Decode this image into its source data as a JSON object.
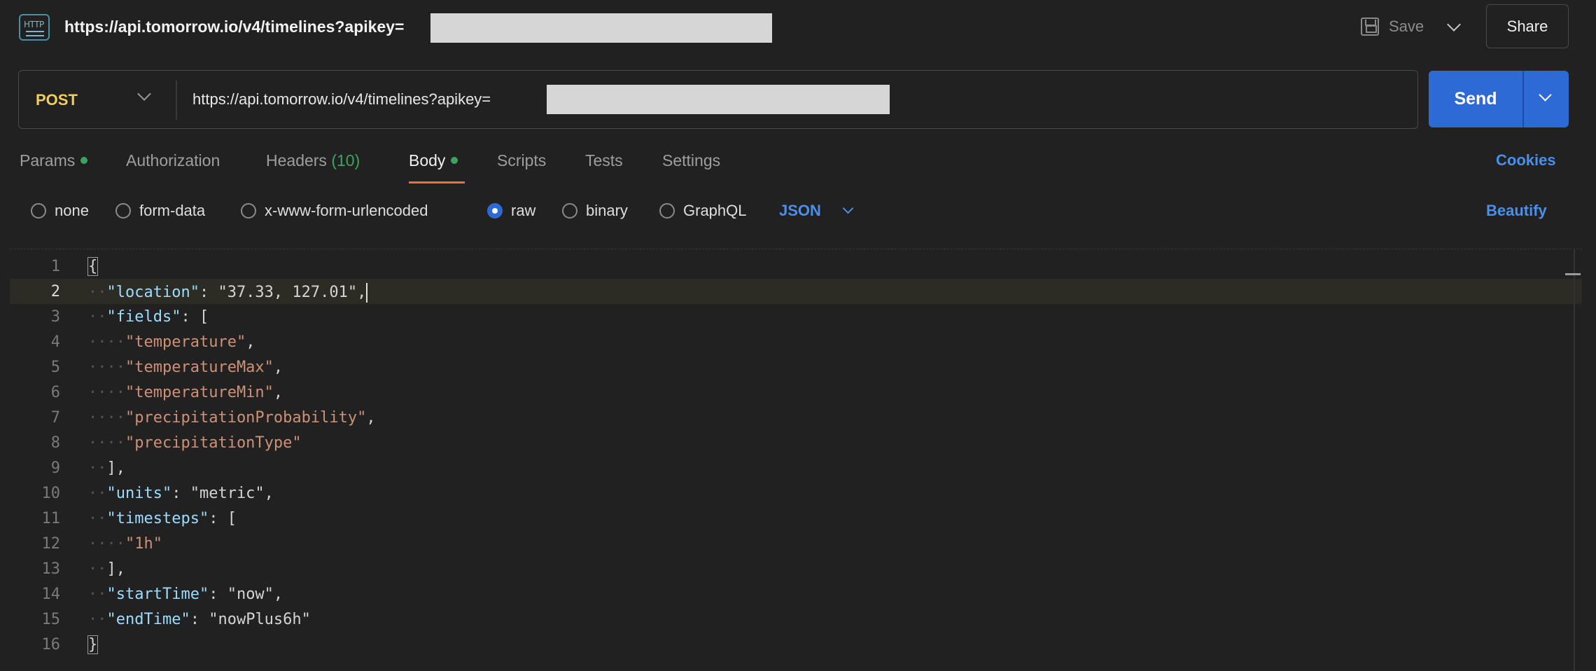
{
  "topbar": {
    "icon": "http-request-icon",
    "icon_text": "HTTP",
    "title": "https://api.tomorrow.io/v4/timelines?apikey=",
    "save_label": "Save",
    "share_label": "Share"
  },
  "request": {
    "method": "POST",
    "url": "https://api.tomorrow.io/v4/timelines?apikey=",
    "send_label": "Send"
  },
  "tabs": [
    {
      "label": "Params",
      "dot": true
    },
    {
      "label": "Authorization"
    },
    {
      "label": "Headers",
      "count": "(10)"
    },
    {
      "label": "Body",
      "dot": true,
      "active": true
    },
    {
      "label": "Scripts"
    },
    {
      "label": "Tests"
    },
    {
      "label": "Settings"
    }
  ],
  "cookies_label": "Cookies",
  "body_types": [
    {
      "label": "none",
      "selected": false
    },
    {
      "label": "form-data",
      "selected": false
    },
    {
      "label": "x-www-form-urlencoded",
      "selected": false
    },
    {
      "label": "raw",
      "selected": true
    },
    {
      "label": "binary",
      "selected": false
    },
    {
      "label": "GraphQL",
      "selected": false
    }
  ],
  "language": "JSON",
  "beautify_label": "Beautify",
  "editor": {
    "current_line": 2,
    "lines": [
      {
        "n": "1",
        "text": "{"
      },
      {
        "n": "2",
        "text": "  \"location\": \"37.33, 127.01\","
      },
      {
        "n": "3",
        "text": "  \"fields\": ["
      },
      {
        "n": "4",
        "text": "    \"temperature\","
      },
      {
        "n": "5",
        "text": "    \"temperatureMax\","
      },
      {
        "n": "6",
        "text": "    \"temperatureMin\","
      },
      {
        "n": "7",
        "text": "    \"precipitationProbability\","
      },
      {
        "n": "8",
        "text": "    \"precipitationType\""
      },
      {
        "n": "9",
        "text": "  ],"
      },
      {
        "n": "10",
        "text": "  \"units\": \"metric\","
      },
      {
        "n": "11",
        "text": "  \"timesteps\": ["
      },
      {
        "n": "12",
        "text": "    \"1h\""
      },
      {
        "n": "13",
        "text": "  ],"
      },
      {
        "n": "14",
        "text": "  \"startTime\": \"now\","
      },
      {
        "n": "15",
        "text": "  \"endTime\": \"nowPlus6h\""
      },
      {
        "n": "16",
        "text": "}"
      }
    ]
  },
  "colors": {
    "accent": "#2e6ad6",
    "method": "#f3cd5b",
    "tab_active_underline": "#f26b3a",
    "dot": "#3ba55d",
    "link": "#4a8fe8"
  }
}
